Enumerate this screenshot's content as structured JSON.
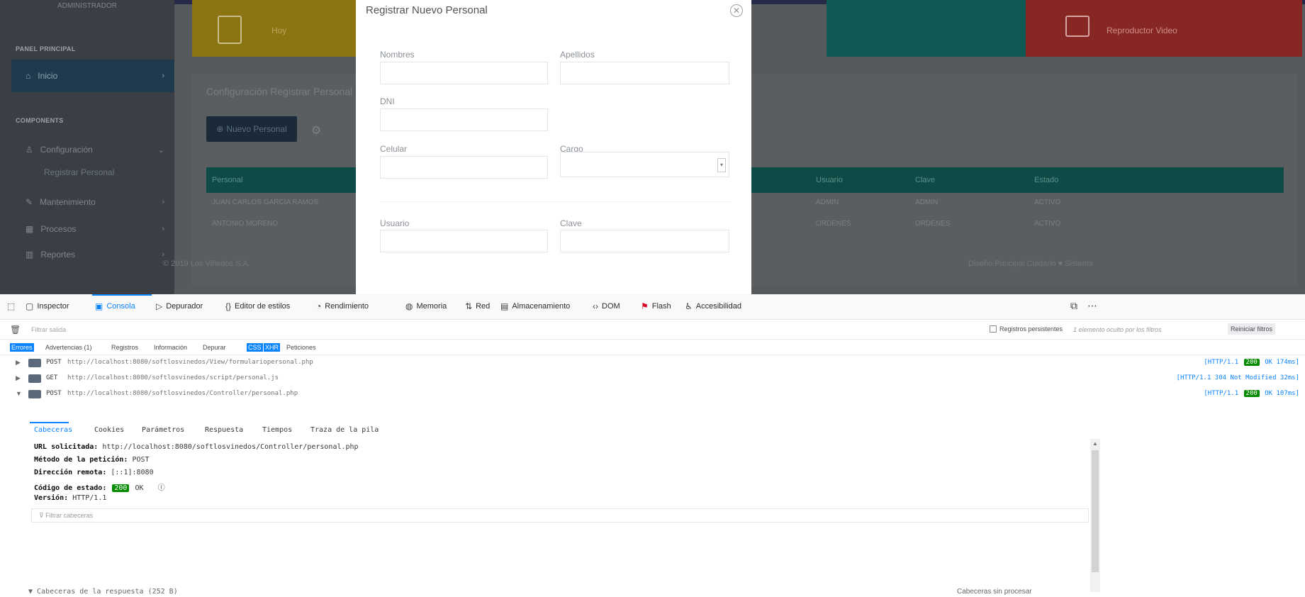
{
  "page": {
    "sidebar": {
      "user_role": "ADMINISTRADOR",
      "heading_main": "PANEL PRINCIPAL",
      "home_label": "Inicio",
      "heading_components": "COMPONENTS",
      "items": [
        {
          "label": "Configuración"
        },
        {
          "label": "Registrar Personal"
        },
        {
          "label": "Mantenimiento"
        },
        {
          "label": "Procesos"
        },
        {
          "label": "Reportes"
        }
      ]
    },
    "tiles": {
      "yellow_label": "Hoy",
      "red_label": "Reproductor Video"
    },
    "panel": {
      "title": "Configuración Registrar Personal",
      "new_button": "Nuevo Personal",
      "columns": [
        "Personal",
        "Usuario",
        "Clave",
        "Estado"
      ],
      "rows": [
        [
          "JUAN CARLOS GARCIA RAMOS",
          "ADMIN",
          "ADMIN",
          "ACTIVO"
        ],
        [
          "ANTONIO MORENO",
          "ORDENES",
          "ORDENES",
          "ACTIVO"
        ]
      ],
      "footer_left": "© 2019 Los Viñedos S.A.",
      "footer_right": "Diseño Principal Cuidarlo ♥ Sistema"
    },
    "modal": {
      "title": "Registrar Nuevo Personal",
      "labels": {
        "nombres": "Nombres",
        "apellidos": "Apellidos",
        "dni": "DNI",
        "celular": "Celular",
        "cargo": "Cargo",
        "usuario": "Usuario",
        "clave": "Clave"
      },
      "values": {
        "nombres": "",
        "apellidos": "",
        "dni": "",
        "celular": "",
        "cargo": "",
        "usuario": "",
        "clave": ""
      }
    }
  },
  "devtools": {
    "tabs": [
      "Inspector",
      "Consola",
      "Depurador",
      "Editor de estilos",
      "Rendimiento",
      "Memoria",
      "Red",
      "Almacenamiento",
      "DOM",
      "Flash",
      "Accesibilidad"
    ],
    "active_tab": "Consola",
    "filter_placeholder": "Filtrar salida",
    "persistent_logs": "Registros persistentes",
    "hidden_message": "1 elemento oculto por los filtros",
    "reset_filters": "Reiniciar filtros",
    "filters": [
      "Errores",
      "Advertencias (1)",
      "Registros",
      "Información",
      "Depurar",
      "CSS",
      "XHR",
      "Peticiones"
    ],
    "requests": [
      {
        "method": "POST",
        "url": "http://localhost:8080/softlosvinedos/View/formulariopersonal.php",
        "status_prefix": "[HTTP/1.1 ",
        "code": "200",
        "status_suffix": " OK 174ms]"
      },
      {
        "method": "GET",
        "url": "http://localhost:8080/softlosvinedos/script/personal.js",
        "status_prefix": "[HTTP/1.1 ",
        "code": "304",
        "status_suffix": " Not Modified 32ms]"
      },
      {
        "method": "POST",
        "url": "http://localhost:8080/softlosvinedos/Controller/personal.php",
        "status_prefix": "[HTTP/1.1 ",
        "code": "200",
        "status_suffix": " OK 107ms]"
      }
    ],
    "detail_tabs": [
      "Cabeceras",
      "Cookies",
      "Parámetros",
      "Respuesta",
      "Tiempos",
      "Traza de la pila"
    ],
    "headers": {
      "url_label": "URL solicitada:",
      "url_value": "http://localhost:8080/softlosvinedos/Controller/personal.php",
      "method_label": "Método de la petición:",
      "method_value": "POST",
      "remote_label": "Dirección remota:",
      "remote_value": "[::1]:8080",
      "status_label": "Código de estado:",
      "status_code": "200",
      "status_text": "OK",
      "version_label": "Versión:",
      "version_value": "HTTP/1.1"
    },
    "header_filter_placeholder": "Filtrar cabeceras",
    "response_headers": "▼ Cabeceras de la respuesta (252 B)",
    "raw_headers": "Cabeceras sin procesar"
  }
}
